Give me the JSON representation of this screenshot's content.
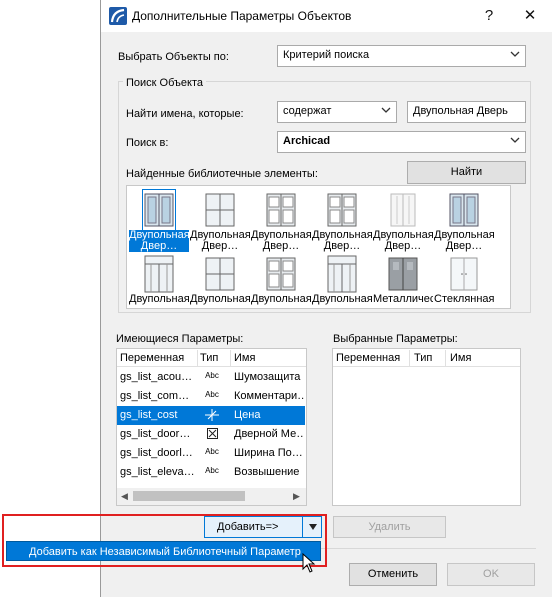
{
  "dialog": {
    "title": "Дополнительные Параметры Объектов",
    "help": "?",
    "close": "✕"
  },
  "select_by": {
    "label": "Выбрать Объекты по:",
    "value": "Критерий поиска"
  },
  "search_group": {
    "title": "Поиск Объекта",
    "find_names_label": "Найти имена, которые:",
    "match_mode": "содержат",
    "search_text": "Двупольная Дверь",
    "search_in_label": "Поиск в:",
    "search_in_value": "Archicad",
    "found_label": "Найденные библиотечные элементы:",
    "find_button": "Найти"
  },
  "library_items": [
    {
      "label": "Двупольная Двер…",
      "icon": "double-door-icon",
      "selected": true
    },
    {
      "label": "Двупольная Двер…",
      "icon": "double-door-grid-icon",
      "selected": false
    },
    {
      "label": "Двупольная Двер…",
      "icon": "double-door-panel-icon",
      "selected": false
    },
    {
      "label": "Двупольная Двер…",
      "icon": "double-door-panel-icon",
      "selected": false
    },
    {
      "label": "Двупольная Двер…",
      "icon": "double-door-light-icon",
      "selected": false
    },
    {
      "label": "Двупольная Двер…",
      "icon": "double-door-icon",
      "selected": false
    },
    {
      "label": "Двупольная…",
      "icon": "double-door-transom-icon",
      "selected": false
    },
    {
      "label": "Двупольная…",
      "icon": "double-door-grid-icon",
      "selected": false
    },
    {
      "label": "Двупольная…",
      "icon": "double-door-panel-icon",
      "selected": false
    },
    {
      "label": "Двупольная…",
      "icon": "double-door-transom-icon",
      "selected": false
    },
    {
      "label": "Металлическая…",
      "icon": "metal-door-icon",
      "selected": false
    },
    {
      "label": "Стеклянная…",
      "icon": "glass-door-icon",
      "selected": false
    }
  ],
  "available_params": {
    "title": "Имеющиеся Параметры:",
    "columns": [
      "Переменная",
      "Тип",
      "Имя"
    ],
    "rows": [
      {
        "var": "gs_list_acou…",
        "type": "Abc",
        "name": "Шумозащита"
      },
      {
        "var": "gs_list_com…",
        "type": "Abc",
        "name": "Комментари…"
      },
      {
        "var": "gs_list_cost",
        "type": "number",
        "name": "Цена",
        "selected": true
      },
      {
        "var": "gs_list_door…",
        "type": "checkbox",
        "name": "Дверной Ме…"
      },
      {
        "var": "gs_list_doorl…",
        "type": "Abc",
        "name": "Ширина По…"
      },
      {
        "var": "gs_list_eleva…",
        "type": "Abc",
        "name": "Возвышение"
      }
    ]
  },
  "selected_params": {
    "title": "Выбранные Параметры:",
    "columns": [
      "Переменная",
      "Тип",
      "Имя"
    ]
  },
  "buttons": {
    "add": "Добавить=>",
    "remove": "Удалить",
    "cancel": "Отменить",
    "ok": "OK"
  },
  "popup": {
    "item": "Добавить как Независимый Библиотечный Параметр"
  }
}
